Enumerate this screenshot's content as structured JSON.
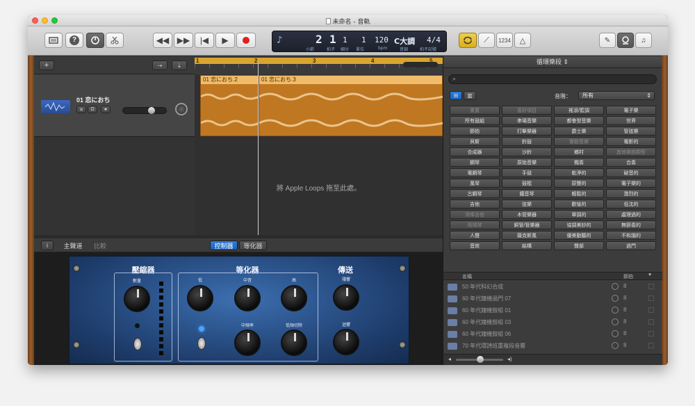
{
  "window": {
    "title": "未命名 - 音軌"
  },
  "toolbar": {
    "lcd": {
      "bar": "2",
      "beat": "1",
      "division": "1",
      "tick": "1",
      "bar_label": "小節",
      "beat_label": "拍子",
      "division_label": "細分",
      "tick_label": "單位",
      "tempo": "120",
      "tempo_label": "bpm",
      "key": "C大調",
      "key_label": "音調",
      "time_signature": "4/4",
      "time_signature_label": "拍子記號"
    },
    "count_in": "1234"
  },
  "ruler": {
    "marks": [
      "1",
      "2",
      "3",
      "4",
      "5"
    ]
  },
  "track": {
    "name": "01 恋におち"
  },
  "regions": [
    {
      "label": "01 恋におち.2"
    },
    {
      "label": "01 恋におち.3"
    }
  ],
  "arrange": {
    "drop_hint": "將 Apple Loops 拖至此處。"
  },
  "editor": {
    "tabs": {
      "track": "主聲道",
      "compare": "比較",
      "controls": "控制器",
      "eq": "等化器"
    },
    "sections": {
      "compressor": "壓縮器",
      "eq": "等化器",
      "sends": "傳送"
    },
    "knobs": {
      "amount": "數量",
      "low": "低",
      "mid": "中音",
      "high": "高",
      "mid_freq": "中頻率",
      "low_cut": "低頻切除",
      "reverb": "殘響",
      "echo": "迴響"
    }
  },
  "loops": {
    "title": "循環樂段",
    "scale_label": "音階：",
    "scale_value": "所有",
    "keywords": [
      [
        "重置",
        "喜好項目",
        "搖滾/藍調",
        "電子樂"
      ],
      [
        "所有鼓組",
        "串場音樂",
        "都會型音樂",
        "世界"
      ],
      [
        "節拍",
        "打擊樂器",
        "爵士樂",
        "管弦樂"
      ],
      [
        "貝斯",
        "鈴鼓",
        "實驗音樂",
        "電影的"
      ],
      [
        "合成器",
        "沙鈴",
        "鄉村",
        "其他樂曲類型"
      ],
      [
        "鋼琴",
        "原始音樂",
        "獨奏",
        "合奏"
      ],
      [
        "電鋼琴",
        "手鼓",
        "乾淨的",
        "破音的"
      ],
      [
        "風琴",
        "鼓棍",
        "原聲的",
        "電子樂的"
      ],
      [
        "古鋼琴",
        "鐵音琴",
        "輕鬆的",
        "激烈的"
      ],
      [
        "吉他",
        "弦樂",
        "歡愉的",
        "低沈的"
      ],
      [
        "滑棒吉他",
        "木管樂器",
        "單調的",
        "處理過的"
      ],
      [
        "斑鳩琴",
        "銅管/管樂器",
        "協調美妙的",
        "無節奏的"
      ],
      [
        "人聲",
        "薩克斯風",
        "優美動聽的",
        "不和諧的"
      ],
      [
        "音效",
        "結構",
        "聲部",
        "過門"
      ]
    ],
    "dim_keywords": [
      "重置",
      "喜好項目",
      "實驗音樂",
      "其他樂曲類型",
      "滑棒吉他",
      "斑鳩琴"
    ],
    "results_header": {
      "name": "名稱",
      "beats": "節拍"
    },
    "results": [
      {
        "name": "50 年代科幻合成",
        "beats": "8"
      },
      {
        "name": "60 年代鐘機過門 07",
        "beats": "8"
      },
      {
        "name": "60 年代鐘機鼓組 01",
        "beats": "8"
      },
      {
        "name": "60 年代鐘機鼓組 03",
        "beats": "8"
      },
      {
        "name": "60 年代鐘機鼓組 06",
        "beats": "8"
      },
      {
        "name": "70 年代環詩班重複段音層",
        "beats": "8"
      },
      {
        "name": "70 年代電鋼琴 06",
        "beats": "8"
      }
    ]
  }
}
